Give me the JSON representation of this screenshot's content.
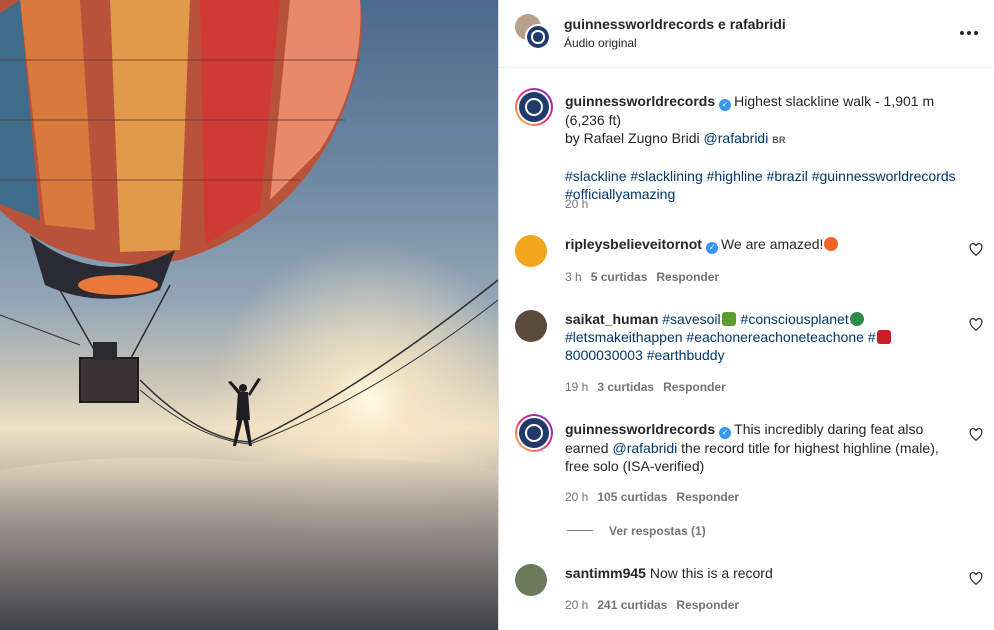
{
  "header": {
    "title": "guinnessworldrecords e rafabridi",
    "subtitle": "Áudio original",
    "more_icon": "more-horizontal-icon"
  },
  "caption": {
    "username": "guinnessworldrecords",
    "text_1": "Highest slackline walk - 1,901 m (6,236 ft)",
    "text_2": "by Rafael Zugno Bridi",
    "mention": "@rafabridi",
    "country": "BR",
    "hashtags_line1": "#slackline #slacklining #highline #brazil #guinnessworldrecords",
    "hashtags_line2": "#officiallyamazing",
    "time": "20 h"
  },
  "comments": [
    {
      "username": "ripleysbelieveitornot",
      "verified": true,
      "text": "We are amazed!",
      "time": "3 h",
      "likes": "5 curtidas",
      "reply": "Responder"
    },
    {
      "username": "saikat_human",
      "line1a": "#savesoil",
      "line1b": "#consciousplanet",
      "line2a": "#letsmakeithappen #eachonereachoneteachone #",
      "line3": "8000030003 #earthbuddy",
      "time": "19 h",
      "likes": "3 curtidas",
      "reply": "Responder"
    },
    {
      "username": "guinnessworldrecords",
      "verified": true,
      "text_1": "This incredibly daring feat also",
      "text_2a": "earned",
      "mention": "@rafabridi",
      "text_2b": "the record title for highest highline (male),",
      "text_3": "free solo (ISA-verified)",
      "time": "20 h",
      "likes": "105 curtidas",
      "reply": "Responder",
      "view_replies": "Ver respostas (1)"
    },
    {
      "username": "santimm945",
      "text": "Now this is a record",
      "time": "20 h",
      "likes": "241 curtidas",
      "reply": "Responder"
    }
  ],
  "colors": {
    "link": "#00376b",
    "verified": "#3897f0",
    "meta": "#737373"
  }
}
